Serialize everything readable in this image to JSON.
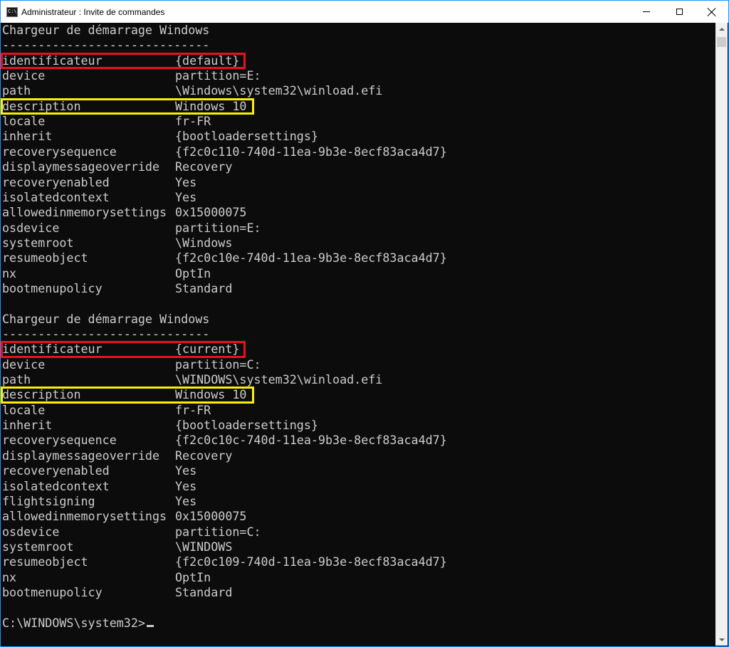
{
  "window": {
    "title": "Administrateur : Invite de commandes",
    "icon_label": "C:\\",
    "colors": {
      "border": "#1e90ff",
      "console_bg": "#0c0c0c",
      "console_fg": "#cccccc",
      "highlight_red": "#e81123",
      "highlight_yellow": "#ffee00"
    }
  },
  "sections": [
    {
      "header": "Chargeur de démarrage Windows",
      "separator": "-----------------------------",
      "entries": [
        {
          "key": "identificateur",
          "value": "{default}"
        },
        {
          "key": "device",
          "value": "partition=E:"
        },
        {
          "key": "path",
          "value": "\\Windows\\system32\\winload.efi"
        },
        {
          "key": "description",
          "value": "Windows 10"
        },
        {
          "key": "locale",
          "value": "fr-FR"
        },
        {
          "key": "inherit",
          "value": "{bootloadersettings}"
        },
        {
          "key": "recoverysequence",
          "value": "{f2c0c110-740d-11ea-9b3e-8ecf83aca4d7}"
        },
        {
          "key": "displaymessageoverride",
          "value": "Recovery"
        },
        {
          "key": "recoveryenabled",
          "value": "Yes"
        },
        {
          "key": "isolatedcontext",
          "value": "Yes"
        },
        {
          "key": "allowedinmemorysettings",
          "value": "0x15000075"
        },
        {
          "key": "osdevice",
          "value": "partition=E:"
        },
        {
          "key": "systemroot",
          "value": "\\Windows"
        },
        {
          "key": "resumeobject",
          "value": "{f2c0c10e-740d-11ea-9b3e-8ecf83aca4d7}"
        },
        {
          "key": "nx",
          "value": "OptIn"
        },
        {
          "key": "bootmenupolicy",
          "value": "Standard"
        }
      ]
    },
    {
      "header": "Chargeur de démarrage Windows",
      "separator": "-----------------------------",
      "entries": [
        {
          "key": "identificateur",
          "value": "{current}"
        },
        {
          "key": "device",
          "value": "partition=C:"
        },
        {
          "key": "path",
          "value": "\\WINDOWS\\system32\\winload.efi"
        },
        {
          "key": "description",
          "value": "Windows 10"
        },
        {
          "key": "locale",
          "value": "fr-FR"
        },
        {
          "key": "inherit",
          "value": "{bootloadersettings}"
        },
        {
          "key": "recoverysequence",
          "value": "{f2c0c10c-740d-11ea-9b3e-8ecf83aca4d7}"
        },
        {
          "key": "displaymessageoverride",
          "value": "Recovery"
        },
        {
          "key": "recoveryenabled",
          "value": "Yes"
        },
        {
          "key": "isolatedcontext",
          "value": "Yes"
        },
        {
          "key": "flightsigning",
          "value": "Yes"
        },
        {
          "key": "allowedinmemorysettings",
          "value": "0x15000075"
        },
        {
          "key": "osdevice",
          "value": "partition=C:"
        },
        {
          "key": "systemroot",
          "value": "\\WINDOWS"
        },
        {
          "key": "resumeobject",
          "value": "{f2c0c109-740d-11ea-9b3e-8ecf83aca4d7}"
        },
        {
          "key": "nx",
          "value": "OptIn"
        },
        {
          "key": "bootmenupolicy",
          "value": "Standard"
        }
      ]
    }
  ],
  "prompt": "C:\\WINDOWS\\system32>"
}
